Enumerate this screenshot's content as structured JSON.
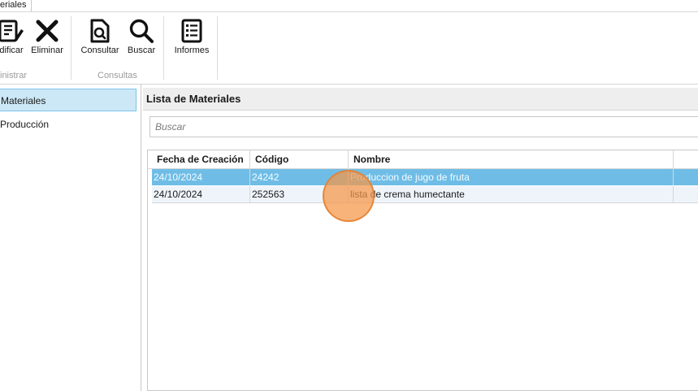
{
  "ribbon": {
    "tab_label": "teriales",
    "buttons": {
      "modificar": "dificar",
      "eliminar": "Eliminar",
      "consultar": "Consultar",
      "buscar": "Buscar",
      "informes": "Informes"
    },
    "groups": {
      "administrar": "inistrar",
      "consultas": "Consultas"
    },
    "icons": {
      "modificar": "edit-document-icon",
      "eliminar": "close-x-icon",
      "consultar": "document-search-icon",
      "buscar": "magnifier-icon",
      "informes": "report-list-icon"
    }
  },
  "sidebar": {
    "items": [
      {
        "label": "Materiales",
        "selected": true
      },
      {
        "label": "Producción",
        "selected": false
      }
    ]
  },
  "main": {
    "title": "Lista de Materiales",
    "search_placeholder": "Buscar",
    "table": {
      "columns": [
        "Fecha de Creación",
        "Código",
        "Nombre"
      ],
      "rows": [
        {
          "fecha": "24/10/2024",
          "codigo": "24242",
          "nombre": "Produccion de  jugo de fruta",
          "selected": true
        },
        {
          "fecha": "24/10/2024",
          "codigo": "252563",
          "nombre": "lista de crema humectante",
          "selected": false
        }
      ]
    }
  },
  "colors": {
    "selection": "#6fbde6",
    "nav_selected": "#cce8f7",
    "cursor_highlight": "#f59646"
  }
}
